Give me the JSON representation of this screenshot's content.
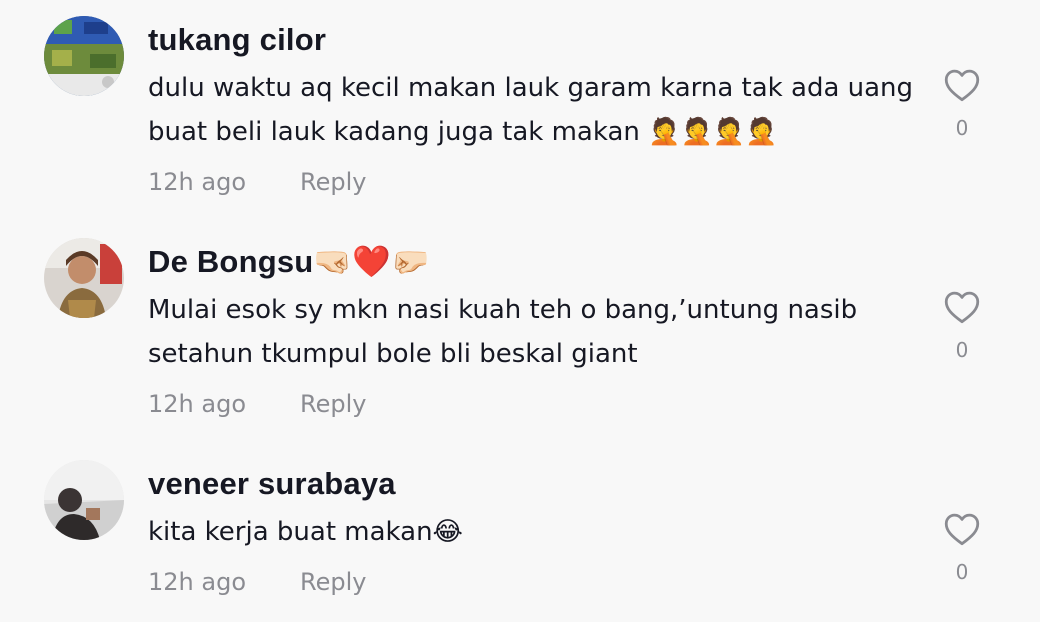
{
  "comments": [
    {
      "username": "tukang cilor",
      "text": "dulu waktu aq kecil makan lauk garam karna tak ada uang buat beli lauk kadang juga tak makan 🤦🤦🤦🤦",
      "time": "12h ago",
      "reply_label": "Reply",
      "likes": "0",
      "avatar_icon": "avatar-photo"
    },
    {
      "username": "De Bongsu🤜🏻❤️🤛🏻",
      "text": "Mulai esok sy mkn nasi kuah teh o bang,’untung nasib setahun tkumpul bole bli beskal giant",
      "time": "12h ago",
      "reply_label": "Reply",
      "likes": "0",
      "avatar_icon": "avatar-photo"
    },
    {
      "username": "veneer surabaya",
      "text": "kita kerja buat makan😂",
      "time": "12h ago",
      "reply_label": "Reply",
      "likes": "0",
      "avatar_icon": "avatar-photo"
    }
  ],
  "icons": {
    "like": "heart-outline-icon"
  },
  "colors": {
    "background": "#f8f8f8",
    "username": "#161823",
    "secondary": "#8a8b91",
    "heart_stroke": "#8a8b91"
  }
}
